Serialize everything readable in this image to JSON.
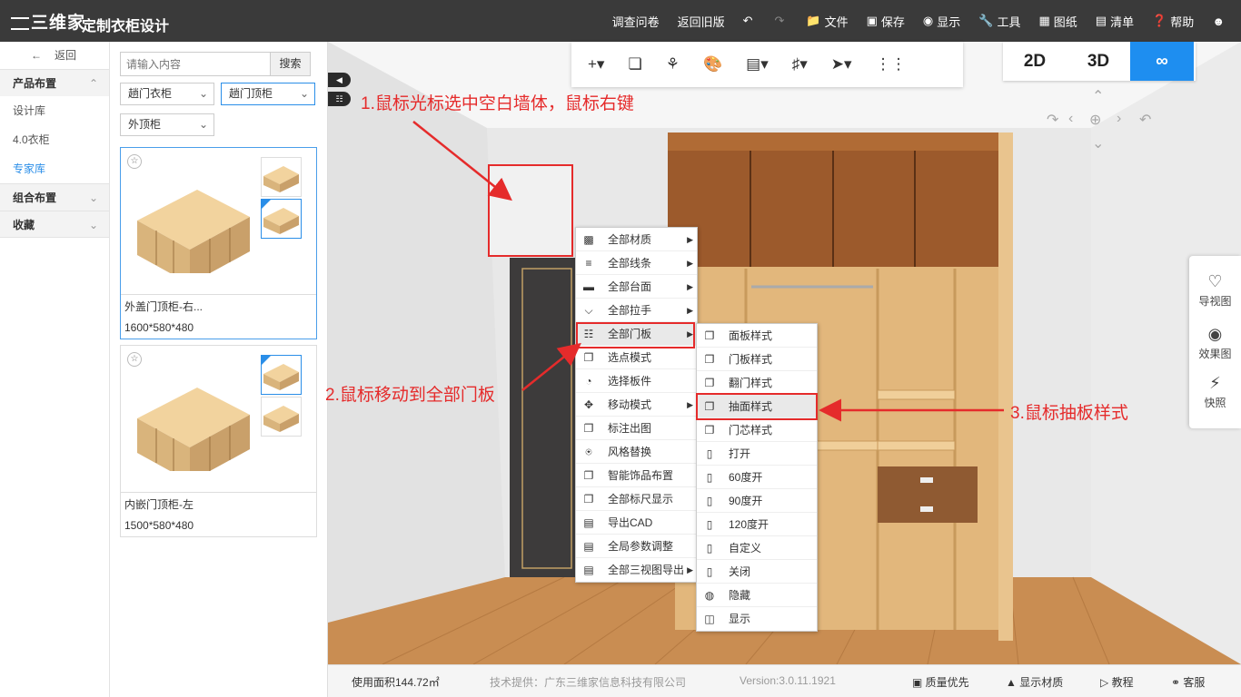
{
  "app": {
    "logo": "三维家",
    "title": "定制衣柜设计"
  },
  "topmenu": [
    {
      "label": "调查问卷",
      "icon": ""
    },
    {
      "label": "返回旧版",
      "icon": ""
    },
    {
      "label": "",
      "icon": "undo-icon"
    },
    {
      "label": "",
      "icon": "redo-icon"
    },
    {
      "label": "文件",
      "icon": "folder-icon"
    },
    {
      "label": "保存",
      "icon": "save-icon"
    },
    {
      "label": "显示",
      "icon": "eye-icon"
    },
    {
      "label": "工具",
      "icon": "wrench-icon"
    },
    {
      "label": "图纸",
      "icon": "map-icon"
    },
    {
      "label": "清单",
      "icon": "list-icon"
    },
    {
      "label": "帮助",
      "icon": "help-icon"
    },
    {
      "label": "",
      "icon": "user-icon"
    }
  ],
  "leftnav": {
    "back": "返回",
    "sections": {
      "product": "产品布置",
      "combo": "组合布置",
      "favorites": "收藏"
    },
    "items": [
      "设计库",
      "4.0衣柜",
      "专家库"
    ]
  },
  "products": {
    "search_placeholder": "请输入内容",
    "search_button": "搜索",
    "filter1": "趟门衣柜",
    "filter2": "趟门顶柜",
    "filter3": "外顶柜",
    "cards": [
      {
        "name": "外盖门顶柜-右...",
        "size": "1600*580*480"
      },
      {
        "name": "内嵌门顶柜-左",
        "size": "1500*580*480"
      }
    ]
  },
  "view": {
    "btn2d": "2D",
    "btn3d": "3D",
    "btnvr": "&#8734;"
  },
  "rightbar": [
    "导视图",
    "效果图",
    "快照"
  ],
  "menu1": [
    {
      "label": "全部材质",
      "sub": true,
      "icon": "checker-icon"
    },
    {
      "label": "全部线条",
      "sub": true,
      "icon": "lines-icon"
    },
    {
      "label": "全部台面",
      "sub": true,
      "icon": "countertop-icon"
    },
    {
      "label": "全部拉手",
      "sub": true,
      "icon": "handle-icon"
    },
    {
      "label": "全部门板",
      "sub": true,
      "icon": "door-icon"
    },
    {
      "label": "选点模式",
      "sub": false,
      "icon": "copy-icon"
    },
    {
      "label": "选择板件",
      "sub": false,
      "icon": "pie-icon"
    },
    {
      "label": "移动模式",
      "sub": true,
      "icon": "move-icon"
    },
    {
      "label": "标注出图",
      "sub": false,
      "icon": "copy-icon"
    },
    {
      "label": "风格替换",
      "sub": false,
      "icon": "shirt-icon"
    },
    {
      "label": "智能饰品布置",
      "sub": false,
      "icon": "copy-icon"
    },
    {
      "label": "全部标尺显示",
      "sub": false,
      "icon": "copy-icon"
    },
    {
      "label": "导出CAD",
      "sub": false,
      "icon": "doc-icon"
    },
    {
      "label": "全局参数调整",
      "sub": false,
      "icon": "doc-icon"
    },
    {
      "label": "全部三视图导出",
      "sub": true,
      "icon": "doc-icon"
    }
  ],
  "menu2": [
    {
      "label": "面板样式",
      "icon": "copy-icon"
    },
    {
      "label": "门板样式",
      "icon": "copy-icon"
    },
    {
      "label": "翻门样式",
      "icon": "copy-icon"
    },
    {
      "label": "抽面样式",
      "icon": "copy-icon"
    },
    {
      "label": "门芯样式",
      "icon": "copy-icon"
    },
    {
      "label": "打开",
      "icon": "page-icon"
    },
    {
      "label": "60度开",
      "icon": "page-icon"
    },
    {
      "label": "90度开",
      "icon": "page-icon"
    },
    {
      "label": "120度开",
      "icon": "page-icon"
    },
    {
      "label": "自定义",
      "icon": "page-icon"
    },
    {
      "label": "关闭",
      "icon": "page-icon"
    },
    {
      "label": "隐藏",
      "icon": "eye-off-icon"
    },
    {
      "label": "显示",
      "icon": "column-icon"
    }
  ],
  "annotations": {
    "step1": "1.鼠标光标选中空白墙体，鼠标右键",
    "step2": "2.鼠标移动到全部门板",
    "step3": "3.鼠标抽板样式"
  },
  "status": {
    "area": "使用面积144.72㎡",
    "provider": "技术提供：广东三维家信息科技有限公司",
    "version": "Version:3.0.11.1921",
    "quality": "质量优先",
    "material": "显示材质",
    "tutorial": "教程",
    "service": "客服"
  },
  "colors": {
    "accent": "#1e8ef0",
    "annotation": "#e52b2b",
    "topbar": "#3a3a3a",
    "wood": "#c9a06a"
  }
}
